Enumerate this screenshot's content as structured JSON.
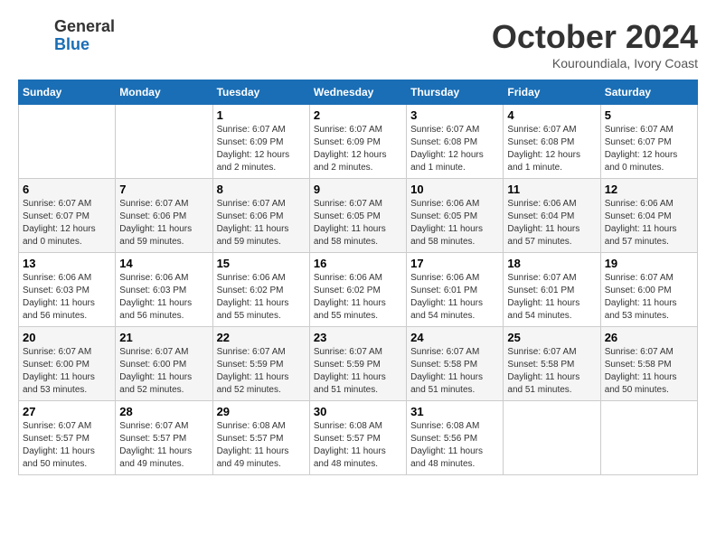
{
  "header": {
    "logo_general": "General",
    "logo_blue": "Blue",
    "month_title": "October 2024",
    "subtitle": "Kouroundiala, Ivory Coast"
  },
  "weekdays": [
    "Sunday",
    "Monday",
    "Tuesday",
    "Wednesday",
    "Thursday",
    "Friday",
    "Saturday"
  ],
  "weeks": [
    [
      {
        "day": "",
        "info": ""
      },
      {
        "day": "",
        "info": ""
      },
      {
        "day": "1",
        "info": "Sunrise: 6:07 AM\nSunset: 6:09 PM\nDaylight: 12 hours\nand 2 minutes."
      },
      {
        "day": "2",
        "info": "Sunrise: 6:07 AM\nSunset: 6:09 PM\nDaylight: 12 hours\nand 2 minutes."
      },
      {
        "day": "3",
        "info": "Sunrise: 6:07 AM\nSunset: 6:08 PM\nDaylight: 12 hours\nand 1 minute."
      },
      {
        "day": "4",
        "info": "Sunrise: 6:07 AM\nSunset: 6:08 PM\nDaylight: 12 hours\nand 1 minute."
      },
      {
        "day": "5",
        "info": "Sunrise: 6:07 AM\nSunset: 6:07 PM\nDaylight: 12 hours\nand 0 minutes."
      }
    ],
    [
      {
        "day": "6",
        "info": "Sunrise: 6:07 AM\nSunset: 6:07 PM\nDaylight: 12 hours\nand 0 minutes."
      },
      {
        "day": "7",
        "info": "Sunrise: 6:07 AM\nSunset: 6:06 PM\nDaylight: 11 hours\nand 59 minutes."
      },
      {
        "day": "8",
        "info": "Sunrise: 6:07 AM\nSunset: 6:06 PM\nDaylight: 11 hours\nand 59 minutes."
      },
      {
        "day": "9",
        "info": "Sunrise: 6:07 AM\nSunset: 6:05 PM\nDaylight: 11 hours\nand 58 minutes."
      },
      {
        "day": "10",
        "info": "Sunrise: 6:06 AM\nSunset: 6:05 PM\nDaylight: 11 hours\nand 58 minutes."
      },
      {
        "day": "11",
        "info": "Sunrise: 6:06 AM\nSunset: 6:04 PM\nDaylight: 11 hours\nand 57 minutes."
      },
      {
        "day": "12",
        "info": "Sunrise: 6:06 AM\nSunset: 6:04 PM\nDaylight: 11 hours\nand 57 minutes."
      }
    ],
    [
      {
        "day": "13",
        "info": "Sunrise: 6:06 AM\nSunset: 6:03 PM\nDaylight: 11 hours\nand 56 minutes."
      },
      {
        "day": "14",
        "info": "Sunrise: 6:06 AM\nSunset: 6:03 PM\nDaylight: 11 hours\nand 56 minutes."
      },
      {
        "day": "15",
        "info": "Sunrise: 6:06 AM\nSunset: 6:02 PM\nDaylight: 11 hours\nand 55 minutes."
      },
      {
        "day": "16",
        "info": "Sunrise: 6:06 AM\nSunset: 6:02 PM\nDaylight: 11 hours\nand 55 minutes."
      },
      {
        "day": "17",
        "info": "Sunrise: 6:06 AM\nSunset: 6:01 PM\nDaylight: 11 hours\nand 54 minutes."
      },
      {
        "day": "18",
        "info": "Sunrise: 6:07 AM\nSunset: 6:01 PM\nDaylight: 11 hours\nand 54 minutes."
      },
      {
        "day": "19",
        "info": "Sunrise: 6:07 AM\nSunset: 6:00 PM\nDaylight: 11 hours\nand 53 minutes."
      }
    ],
    [
      {
        "day": "20",
        "info": "Sunrise: 6:07 AM\nSunset: 6:00 PM\nDaylight: 11 hours\nand 53 minutes."
      },
      {
        "day": "21",
        "info": "Sunrise: 6:07 AM\nSunset: 6:00 PM\nDaylight: 11 hours\nand 52 minutes."
      },
      {
        "day": "22",
        "info": "Sunrise: 6:07 AM\nSunset: 5:59 PM\nDaylight: 11 hours\nand 52 minutes."
      },
      {
        "day": "23",
        "info": "Sunrise: 6:07 AM\nSunset: 5:59 PM\nDaylight: 11 hours\nand 51 minutes."
      },
      {
        "day": "24",
        "info": "Sunrise: 6:07 AM\nSunset: 5:58 PM\nDaylight: 11 hours\nand 51 minutes."
      },
      {
        "day": "25",
        "info": "Sunrise: 6:07 AM\nSunset: 5:58 PM\nDaylight: 11 hours\nand 51 minutes."
      },
      {
        "day": "26",
        "info": "Sunrise: 6:07 AM\nSunset: 5:58 PM\nDaylight: 11 hours\nand 50 minutes."
      }
    ],
    [
      {
        "day": "27",
        "info": "Sunrise: 6:07 AM\nSunset: 5:57 PM\nDaylight: 11 hours\nand 50 minutes."
      },
      {
        "day": "28",
        "info": "Sunrise: 6:07 AM\nSunset: 5:57 PM\nDaylight: 11 hours\nand 49 minutes."
      },
      {
        "day": "29",
        "info": "Sunrise: 6:08 AM\nSunset: 5:57 PM\nDaylight: 11 hours\nand 49 minutes."
      },
      {
        "day": "30",
        "info": "Sunrise: 6:08 AM\nSunset: 5:57 PM\nDaylight: 11 hours\nand 48 minutes."
      },
      {
        "day": "31",
        "info": "Sunrise: 6:08 AM\nSunset: 5:56 PM\nDaylight: 11 hours\nand 48 minutes."
      },
      {
        "day": "",
        "info": ""
      },
      {
        "day": "",
        "info": ""
      }
    ]
  ]
}
